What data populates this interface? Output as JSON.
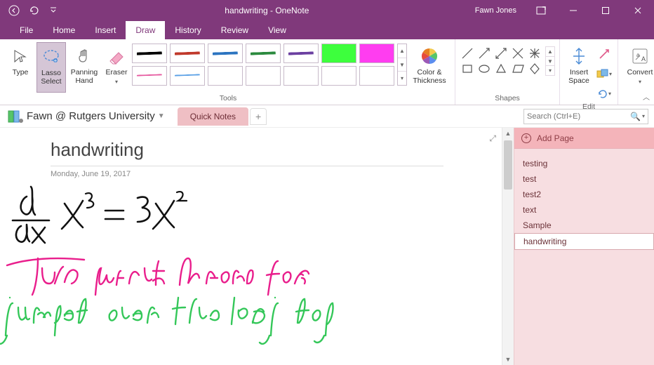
{
  "window": {
    "title": "handwriting  -  OneNote",
    "user": "Fawn Jones"
  },
  "tabs": {
    "items": [
      "File",
      "Home",
      "Insert",
      "Draw",
      "History",
      "Review",
      "View"
    ],
    "active_index": 3
  },
  "ribbon": {
    "type_label": "Type",
    "lasso_label": "Lasso Select",
    "panning_label": "Panning Hand",
    "eraser_label": "Eraser",
    "tools_group": "Tools",
    "pens_row1": [
      {
        "color": "#000000",
        "thick": true
      },
      {
        "color": "#c0392b",
        "thick": true
      },
      {
        "color": "#2b74c0",
        "thick": true
      },
      {
        "color": "#2b8a3e",
        "thick": true
      },
      {
        "color": "#6b3fa0",
        "thick": true
      },
      {
        "highlight": "#3dff3d"
      },
      {
        "highlight": "#ff3df0"
      }
    ],
    "pens_row2": [
      {
        "color": "#e65aa0",
        "thick": false
      },
      {
        "color": "#5aa0e6",
        "thick": false
      },
      {
        "empty": true
      },
      {
        "empty": true
      },
      {
        "empty": true
      },
      {
        "empty": true
      },
      {
        "empty": true
      }
    ],
    "color_thickness_label": "Color & Thickness",
    "shapes_group": "Shapes",
    "insert_space_label": "Insert Space",
    "edit_group": "Edit",
    "convert_label": "Convert"
  },
  "notebook": {
    "name": "Fawn @ Rutgers University",
    "section": "Quick Notes",
    "search_placeholder": "Search (Ctrl+E)"
  },
  "page": {
    "title": "handwriting",
    "date": "Monday, June 19, 2017"
  },
  "handwriting": {
    "formula_desc": "d/dx x^3 = 3x^2",
    "pink_line": "The quick brown fox",
    "green_line": "jumped over the lazy dog"
  },
  "sidepane": {
    "add_label": "Add Page",
    "pages": [
      "testing",
      "test",
      "test2",
      "text",
      "Sample",
      "handwriting"
    ],
    "selected_index": 5
  }
}
